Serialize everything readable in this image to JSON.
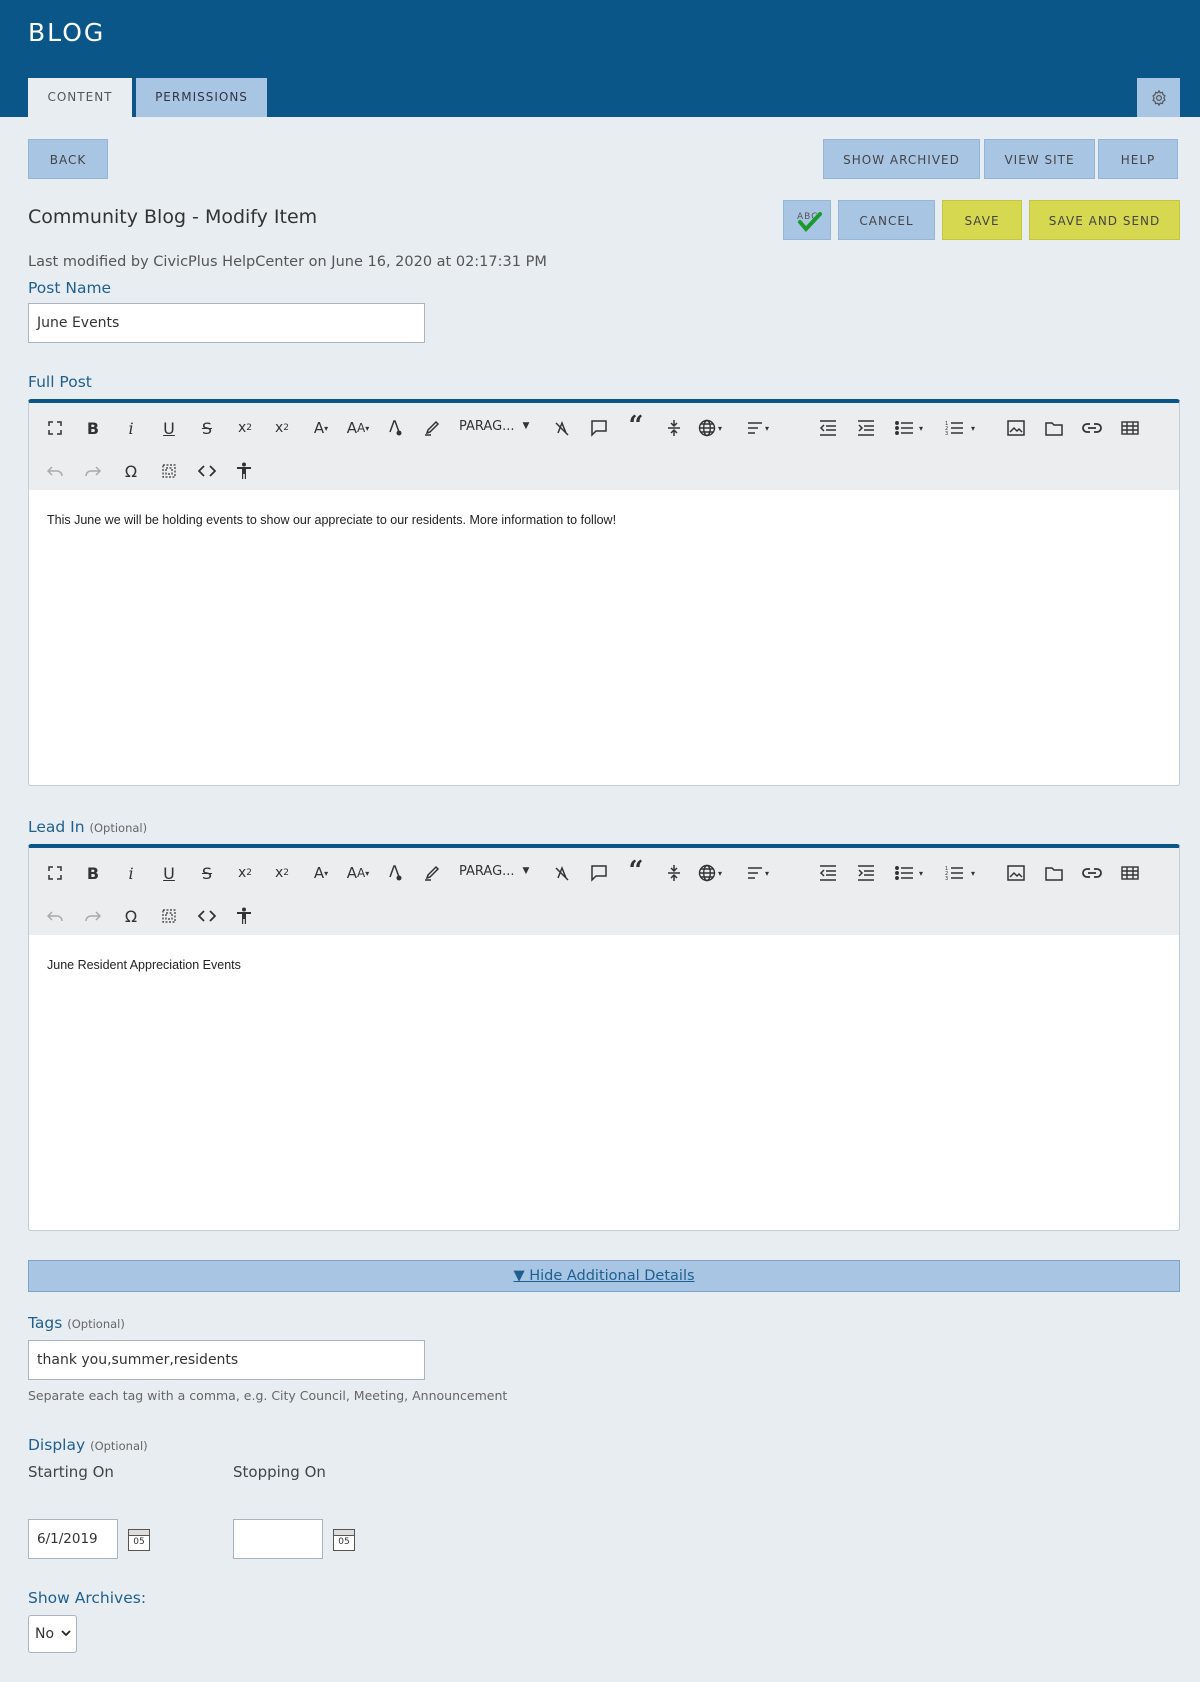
{
  "header": {
    "title": "BLOG",
    "tabs": [
      {
        "label": "CONTENT"
      },
      {
        "label": "PERMISSIONS"
      }
    ]
  },
  "actions": {
    "back": "BACK",
    "show_archived": "SHOW ARCHIVED",
    "view_site": "VIEW SITE",
    "help": "HELP",
    "cancel": "CANCEL",
    "save": "SAVE",
    "save_and_send": "SAVE AND SEND"
  },
  "page": {
    "title": "Community Blog - Modify Item",
    "last_modified": "Last modified by CivicPlus HelpCenter on June 16, 2020 at 02:17:31 PM"
  },
  "form": {
    "post_name": {
      "label": "Post Name",
      "value": "June Events"
    },
    "full_post": {
      "label": "Full Post",
      "paragraph_dropdown": "PARAG...",
      "content": "This June we will be holding events to show our appreciate to our residents. More information to follow!"
    },
    "lead_in": {
      "label": "Lead In",
      "optional": "(Optional)",
      "paragraph_dropdown": "PARAG...",
      "content": "June Resident Appreciation Events"
    },
    "details_toggle": "▼ Hide Additional Details",
    "tags": {
      "label": "Tags",
      "optional": "(Optional)",
      "value": "thank you,summer,residents",
      "hint": "Separate each tag with a comma, e.g. City Council, Meeting, Announcement"
    },
    "display": {
      "label": "Display",
      "optional": "(Optional)",
      "starting_on": {
        "label": "Starting On",
        "value": "6/1/2019",
        "calendar_day": "05"
      },
      "stopping_on": {
        "label": "Stopping On",
        "value": "",
        "calendar_day": "05"
      }
    },
    "show_archives": {
      "label": "Show Archives:",
      "value": "No"
    }
  }
}
